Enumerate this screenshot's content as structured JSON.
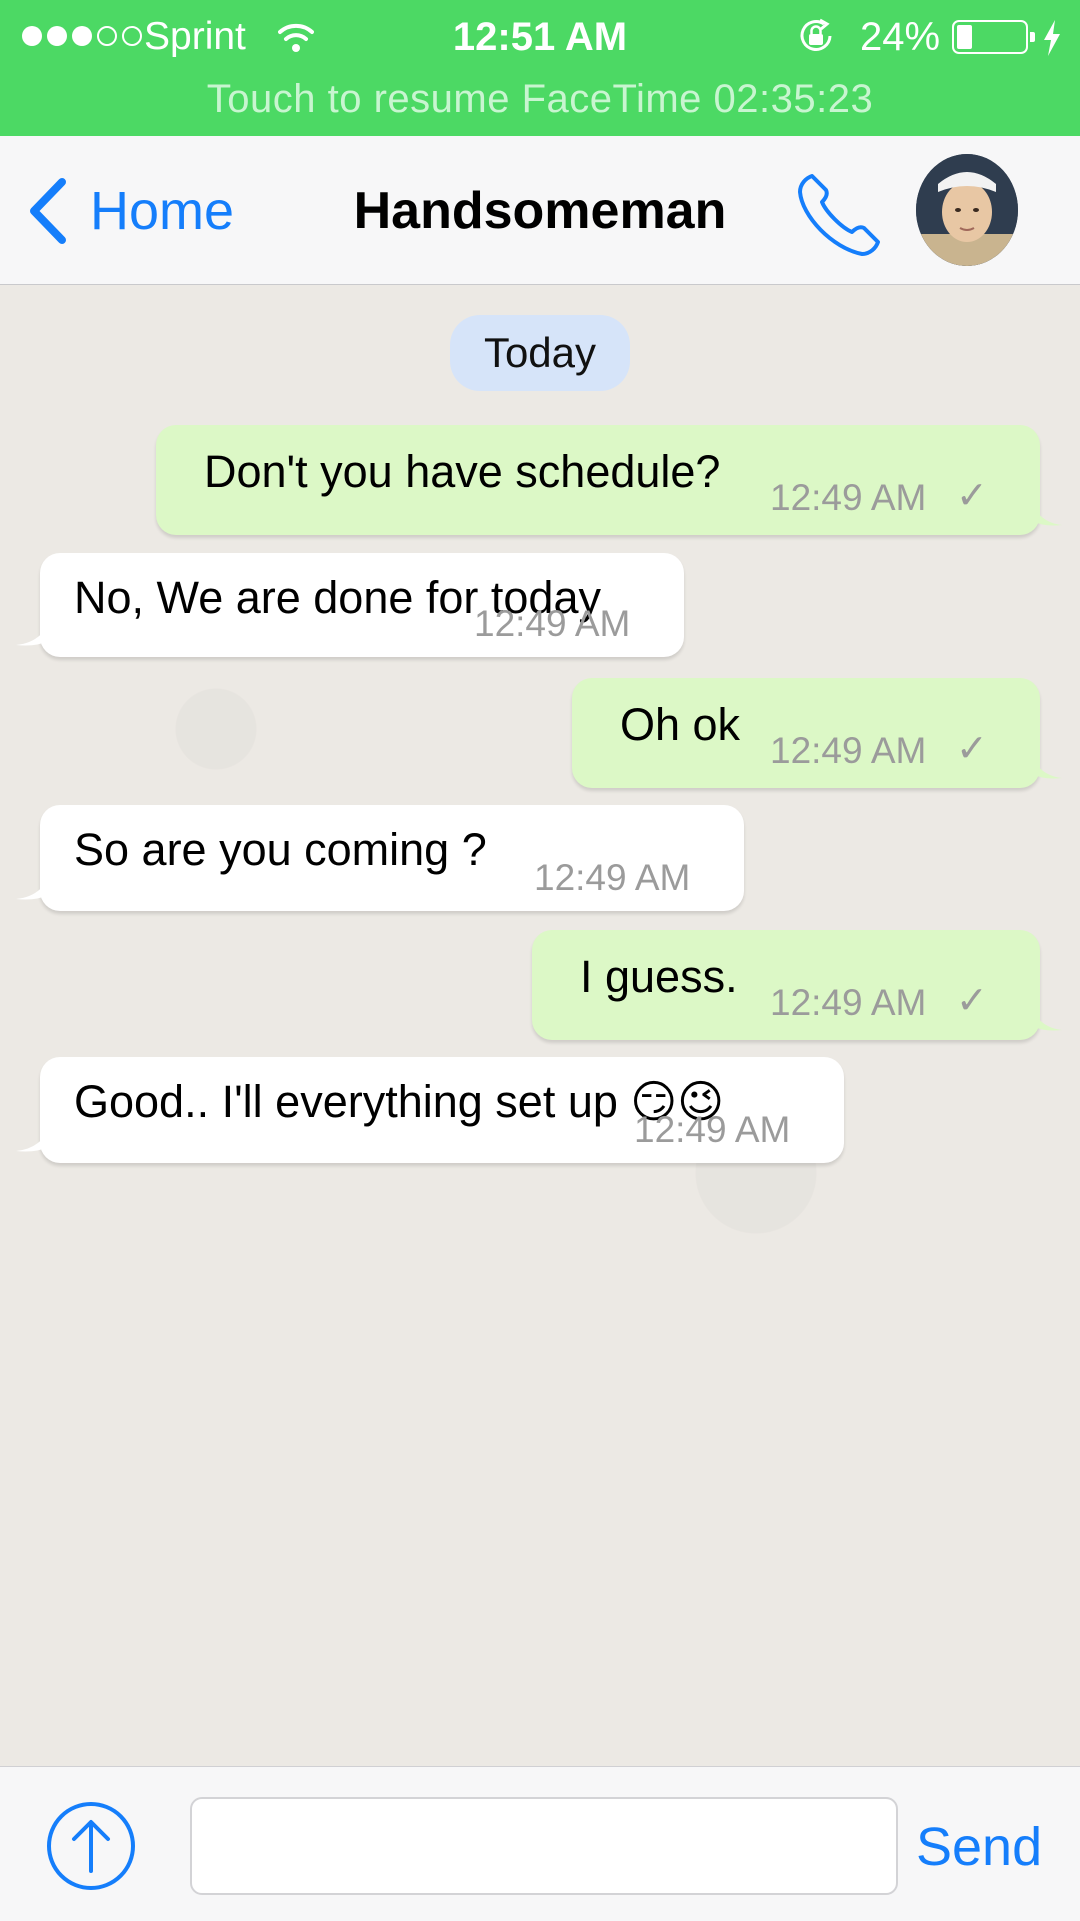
{
  "status_bar": {
    "carrier": "Sprint",
    "time": "12:51 AM",
    "battery_percent": "24%",
    "battery_level": 0.24,
    "signal_bars_filled": 3,
    "signal_bars_total": 5,
    "facetime_banner": "Touch to resume FaceTime 02:35:23",
    "color": "#4cd964"
  },
  "nav": {
    "back_label": "Home",
    "title": "Handsomeman",
    "accent_color": "#157efb",
    "icons": [
      "chevron-left-icon",
      "phone-icon",
      "avatar"
    ]
  },
  "chat": {
    "date_label": "Today",
    "messages": [
      {
        "direction": "out",
        "text": "Don't you have schedule?",
        "time": "12:49 AM",
        "status": "✓"
      },
      {
        "direction": "in",
        "text": "No, We are done for today",
        "time": "12:49 AM"
      },
      {
        "direction": "out",
        "text": "Oh ok",
        "time": "12:49 AM",
        "status": "✓"
      },
      {
        "direction": "in",
        "text": "So are you coming ?",
        "time": "12:49 AM"
      },
      {
        "direction": "out",
        "text": "I guess.",
        "time": "12:49 AM",
        "status": "✓"
      },
      {
        "direction": "in",
        "text": "Good.. I'll everything set up 😏😉",
        "time": "12:49 AM"
      }
    ]
  },
  "input_bar": {
    "placeholder": "",
    "value": "",
    "send_label": "Send",
    "attach_icon": "upload-arrow-icon"
  }
}
